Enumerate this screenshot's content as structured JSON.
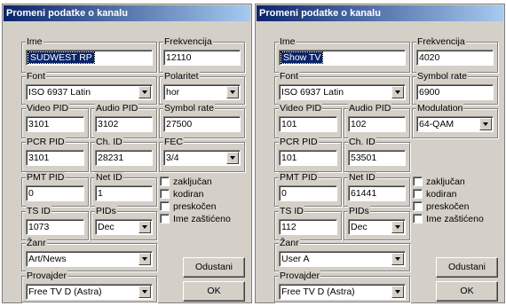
{
  "dialogs": [
    {
      "title": "Promeni podatke o kanalu",
      "ime": {
        "label": "Ime",
        "value": "SUDWEST RP"
      },
      "frekvencija": {
        "label": "Frekvencija",
        "value": "12110"
      },
      "font": {
        "label": "Font",
        "value": "ISO 6937 Latin"
      },
      "polaritet": {
        "label": "Polaritet",
        "value": "hor"
      },
      "video_pid": {
        "label": "Video PID",
        "value": "3101"
      },
      "audio_pid": {
        "label": "Audio PID",
        "value": "3102"
      },
      "symbol_rate": {
        "label": "Symbol rate",
        "value": "27500"
      },
      "pcr_pid": {
        "label": "PCR PID",
        "value": "3101"
      },
      "ch_id": {
        "label": "Ch. ID",
        "value": "28231"
      },
      "fec": {
        "label": "FEC",
        "value": "3/4"
      },
      "pmt_pid": {
        "label": "PMT PID",
        "value": "0"
      },
      "net_id": {
        "label": "Net ID",
        "value": "1"
      },
      "ts_id": {
        "label": "TS ID",
        "value": "1073"
      },
      "pids": {
        "label": "PIDs",
        "value": "Dec"
      },
      "zanr": {
        "label": "Žanr",
        "value": "Art/News"
      },
      "provajder": {
        "label": "Provajder",
        "value": "Free TV D (Astra)"
      },
      "checkboxes": [
        "zaključan",
        "kodiran",
        "preskočen",
        "Ime zaštićeno"
      ],
      "cancel": "Odustani",
      "ok": "OK"
    },
    {
      "title": "Promeni podatke o kanalu",
      "ime": {
        "label": "Ime",
        "value": "Show TV"
      },
      "frekvencija": {
        "label": "Frekvencija",
        "value": "4020"
      },
      "font": {
        "label": "Font",
        "value": "ISO 6937 Latin"
      },
      "symbol_rate": {
        "label": "Symbol rate",
        "value": "6900"
      },
      "video_pid": {
        "label": "Video PID",
        "value": "101"
      },
      "audio_pid": {
        "label": "Audio PID",
        "value": "102"
      },
      "modulation": {
        "label": "Modulation",
        "value": "64-QAM"
      },
      "pcr_pid": {
        "label": "PCR PID",
        "value": "101"
      },
      "ch_id": {
        "label": "Ch. ID",
        "value": "53501"
      },
      "pmt_pid": {
        "label": "PMT PID",
        "value": "0"
      },
      "net_id": {
        "label": "Net ID",
        "value": "61441"
      },
      "ts_id": {
        "label": "TS ID",
        "value": "112"
      },
      "pids": {
        "label": "PIDs",
        "value": "Dec"
      },
      "zanr": {
        "label": "Žanr",
        "value": "User A"
      },
      "provajder": {
        "label": "Provajder",
        "value": "Free TV D (Astra)"
      },
      "checkboxes": [
        "zaključan",
        "kodiran",
        "preskočen",
        "Ime zaštićeno"
      ],
      "cancel": "Odustani",
      "ok": "OK"
    }
  ]
}
